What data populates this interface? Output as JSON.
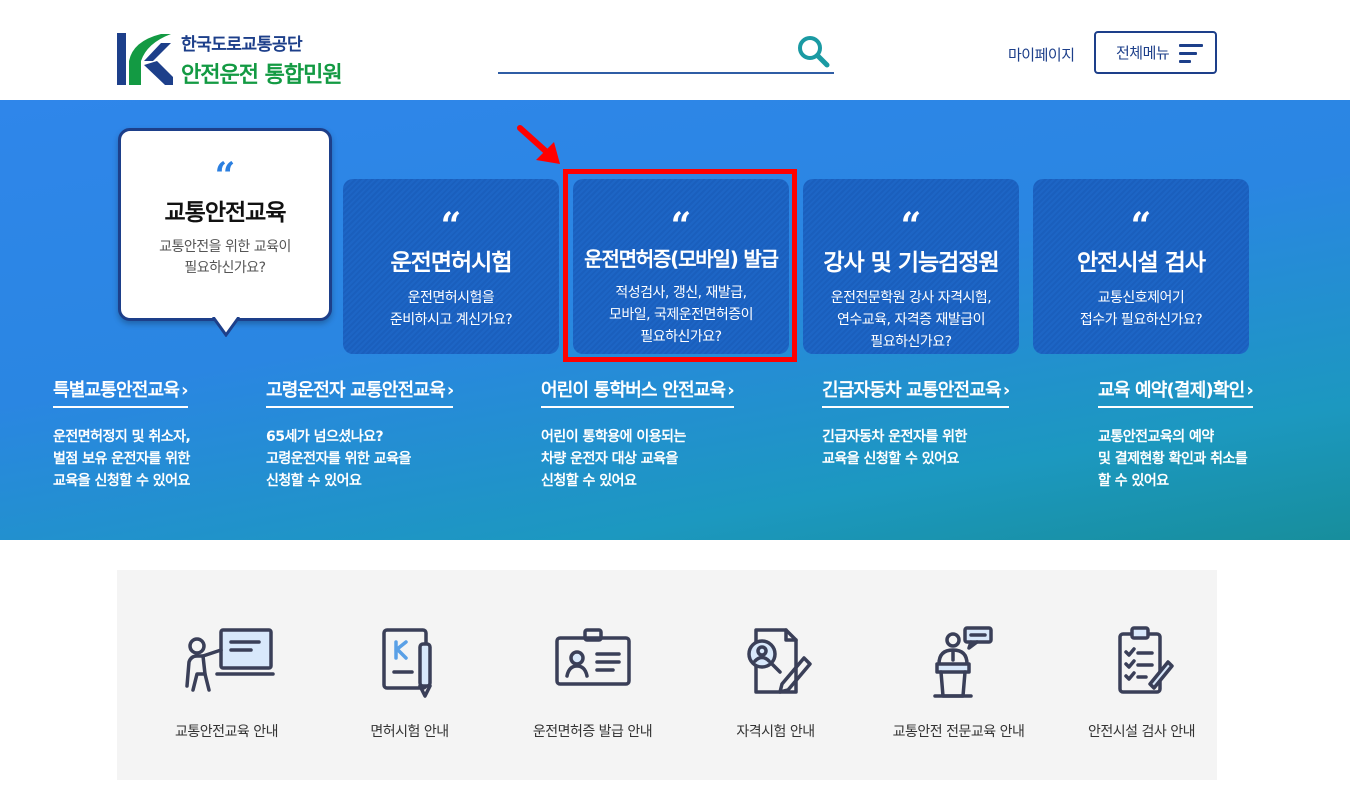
{
  "header": {
    "org_name": "한국도로교통공단",
    "site_title": "안전운전 통합민원",
    "search_placeholder": "",
    "mypage_label": "마이페이지",
    "allmenu_label": "전체메뉴"
  },
  "hero": {
    "bubble": {
      "title": "교통안전교육",
      "desc_line1": "교통안전을 위한 교육이",
      "desc_line2": "필요하신가요?"
    },
    "cards": [
      {
        "title": "운전면허시험",
        "lines": [
          "운전면허시험을",
          "준비하시고 계신가요?"
        ]
      },
      {
        "title": "운전면허증(모바일) 발급",
        "lines": [
          "적성검사, 갱신, 재발급,",
          "모바일, 국제운전면허증이",
          "필요하신가요?"
        ]
      },
      {
        "title": "강사 및 기능검정원",
        "lines": [
          "운전전문학원 강사 자격시험,",
          "연수교육, 자격증 재발급이",
          "필요하신가요?"
        ]
      },
      {
        "title": "안전시설 검사",
        "lines": [
          "교통신호제어기",
          "접수가 필요하신가요?"
        ]
      }
    ],
    "quote_mark": "“",
    "links": [
      {
        "title": "특별교통안전교육",
        "lines": [
          "운전면허정지 및 취소자,",
          "벌점 보유 운전자를 위한",
          "교육을 신청할 수 있어요"
        ]
      },
      {
        "title": "고령운전자 교통안전교육",
        "lines": [
          "65세가 넘으셨나요?",
          "고령운전자를 위한 교육을",
          "신청할 수 있어요"
        ]
      },
      {
        "title": "어린이 통학버스 안전교육",
        "lines": [
          "어린이 통학용에 이용되는",
          "차량 운전자 대상 교육을",
          "신청할 수 있어요"
        ]
      },
      {
        "title": "긴급자동차 교통안전교육",
        "lines": [
          "긴급자동차 운전자를 위한",
          "교육을 신청할 수 있어요"
        ]
      },
      {
        "title": "교육 예약(결제)확인",
        "lines": [
          "교통안전교육의 예약",
          "및 결제현황 확인과 취소를",
          "할 수 있어요"
        ]
      }
    ],
    "chevron": "›"
  },
  "guide": {
    "items": [
      {
        "label": "교통안전교육 안내",
        "icon": "lecture-icon"
      },
      {
        "label": "면허시험 안내",
        "icon": "license-book-icon"
      },
      {
        "label": "운전면허증 발급 안내",
        "icon": "id-card-icon"
      },
      {
        "label": "자격시험 안내",
        "icon": "exam-document-icon"
      },
      {
        "label": "교통안전 전문교육 안내",
        "icon": "speaker-podium-icon"
      },
      {
        "label": "안전시설 검사 안내",
        "icon": "checklist-icon"
      }
    ]
  },
  "colors": {
    "brand_navy": "#1d3f8a",
    "brand_green": "#139a43",
    "card_blue": "#1a5fbd",
    "highlight_red": "#ff0000"
  }
}
